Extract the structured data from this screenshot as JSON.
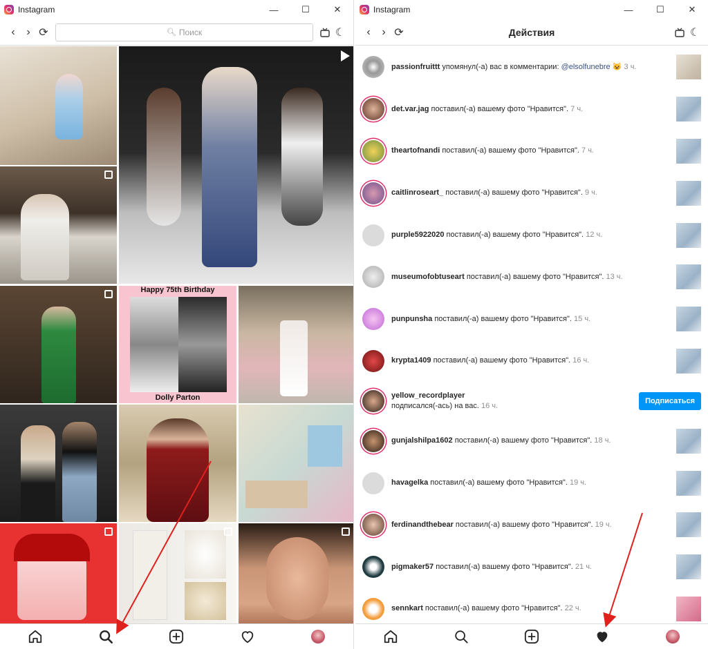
{
  "left": {
    "title": "Instagram",
    "search_placeholder": "Поиск",
    "grid": [
      {
        "cap": "",
        "badge": ""
      },
      {
        "cap": "",
        "badge": "video"
      },
      {
        "cap": "",
        "badge": "multi"
      },
      {
        "cap": "",
        "badge": "multi"
      },
      {
        "cap": "Happy 75th Birthday",
        "cap2": "Dolly Parton",
        "badge": ""
      },
      {
        "cap": "",
        "badge": ""
      },
      {
        "cap": "",
        "badge": ""
      },
      {
        "cap": "",
        "badge": ""
      },
      {
        "cap": "",
        "badge": ""
      },
      {
        "cap": "",
        "badge": "multi"
      },
      {
        "cap": "",
        "badge": "multi"
      },
      {
        "cap": "",
        "badge": ""
      }
    ]
  },
  "right": {
    "title": "Instagram",
    "page_title": "Действия",
    "follow_label": "Подписаться",
    "activities": [
      {
        "user": "passionfruittt",
        "action": "упомянул(-а) вас в комментарии:",
        "mention": "@elsolfunebre",
        "emoji": "😺",
        "time": "3 ч."
      },
      {
        "user": "det.var.jag",
        "action": "поставил(-а) вашему фото \"Нравится\".",
        "time": "7 ч."
      },
      {
        "user": "theartofnandi",
        "action": "поставил(-а) вашему фото \"Нравится\".",
        "time": "7 ч."
      },
      {
        "user": "caitlinroseart_",
        "action": "поставил(-а) вашему фото \"Нравится\".",
        "time": "9 ч."
      },
      {
        "user": "purple5922020",
        "action": "поставил(-а) вашему фото \"Нравится\".",
        "time": "12 ч."
      },
      {
        "user": "museumofobtuseart",
        "action": "поставил(-а) вашему фото \"Нравится\".",
        "time": "13 ч."
      },
      {
        "user": "punpunsha",
        "action": "поставил(-а) вашему фото \"Нравится\".",
        "time": "15 ч."
      },
      {
        "user": "krypta1409",
        "action": "поставил(-а) вашему фото \"Нравится\".",
        "time": "16 ч."
      },
      {
        "user": "yellow_recordplayer",
        "action": "подписался(-ась) на вас.",
        "time": "16 ч."
      },
      {
        "user": "gunjalshilpa1602",
        "action": "поставил(-а) вашему фото \"Нравится\".",
        "time": "18 ч."
      },
      {
        "user": "havagelka",
        "action": "поставил(-а) вашему фото \"Нравится\".",
        "time": "19 ч."
      },
      {
        "user": "ferdinandthebear",
        "action": "поставил(-а) вашему фото \"Нравится\".",
        "time": "19 ч."
      },
      {
        "user": "pigmaker57",
        "action": "поставил(-а) вашему фото \"Нравится\".",
        "time": "21 ч."
      },
      {
        "user": "sennkart",
        "action": "поставил(-а) вашему фото \"Нравится\".",
        "time": "22 ч."
      }
    ]
  },
  "colors": {
    "accent": "#0095f6",
    "ring": "#e1306c",
    "arrow": "#e0201c"
  }
}
